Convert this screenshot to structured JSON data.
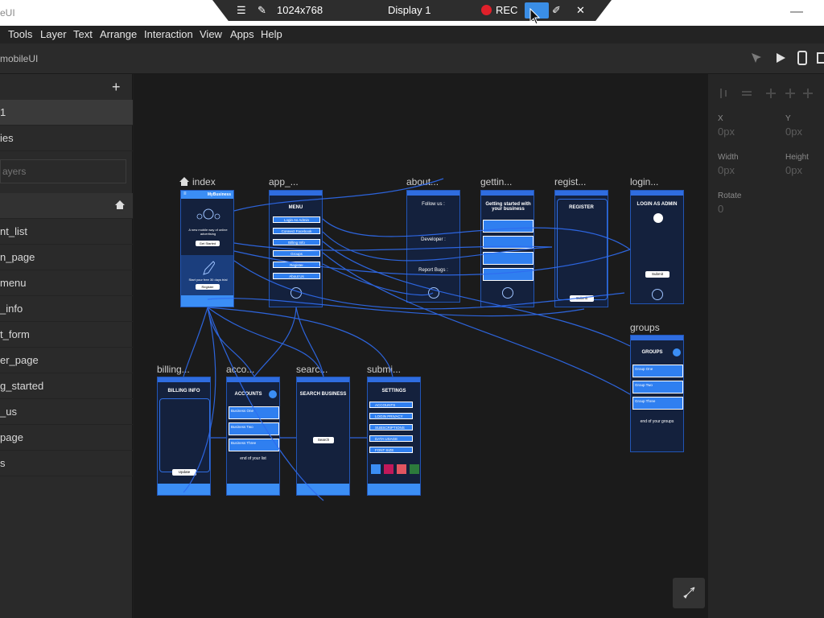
{
  "titlebar": {
    "app_title": "eUI",
    "minimize": "—"
  },
  "remote_bar": {
    "resolution": "1024x768",
    "display": "Display 1",
    "rec": "REC"
  },
  "menu": [
    "Tools",
    "Layer",
    "Text",
    "Arrange",
    "Interaction",
    "View",
    "Apps",
    "Help"
  ],
  "toolbar": {
    "project": "mobileUI"
  },
  "sidebar": {
    "add": "+",
    "item_1": "1",
    "item_2": "ies",
    "search_placeholder": "ayers",
    "screens": [
      "nt_list",
      "n_page",
      "menu",
      "_info",
      "t_form",
      "er_page",
      "g_started",
      "_us",
      "page",
      "s"
    ]
  },
  "properties": {
    "x_label": "X",
    "x_value": "0px",
    "y_label": "Y",
    "y_value": "0px",
    "width_label": "Width",
    "width_value": "0px",
    "height_label": "Height",
    "height_value": "0px",
    "rotate_label": "Rotate",
    "rotate_value": "0"
  },
  "screens": {
    "index": {
      "label": "index",
      "brand": "MyBusiness",
      "tagline": "A new mobile way of online advertising",
      "cta": "Get Started",
      "trial": "Start your free 30 days trial",
      "register": "Register"
    },
    "app": {
      "label": "app_...",
      "title": "MENU",
      "items": [
        "Login As Admin",
        "Connect Facebook",
        "Billing Info",
        "Groups",
        "Register",
        "About Us"
      ]
    },
    "about": {
      "label": "about...",
      "follow": "Follow us :",
      "developer": "Developer :",
      "report": "Report Bugs :"
    },
    "getting": {
      "label": "gettin...",
      "title": "Getting started with your business"
    },
    "register": {
      "label": "regist...",
      "title": "REGISTER",
      "submit": "Submit"
    },
    "login": {
      "label": "login...",
      "title": "LOGIN AS ADMIN",
      "submit": "Submit"
    },
    "groups": {
      "label": "groups",
      "title": "GROUPS",
      "items": [
        "Group One",
        "Group Two",
        "Group Three"
      ],
      "end": "end of your groups"
    },
    "billing": {
      "label": "billing...",
      "title": "BILLING INFO",
      "update": "Update"
    },
    "accounts": {
      "label": "acco...",
      "title": "ACCOUNTS",
      "items": [
        "Business One",
        "Business Two",
        "Business Three"
      ],
      "end": "end of your list"
    },
    "search": {
      "label": "searc...",
      "title": "SEARCH BUSINESS",
      "search": "Search"
    },
    "settings": {
      "label": "submi...",
      "title": "SETTINGS",
      "items": [
        "ACCOUNTS",
        "LOGIN PRIVACY",
        "SUBSCRIPTIONS",
        "DATA USAGE",
        "FONT SIZE"
      ]
    }
  }
}
